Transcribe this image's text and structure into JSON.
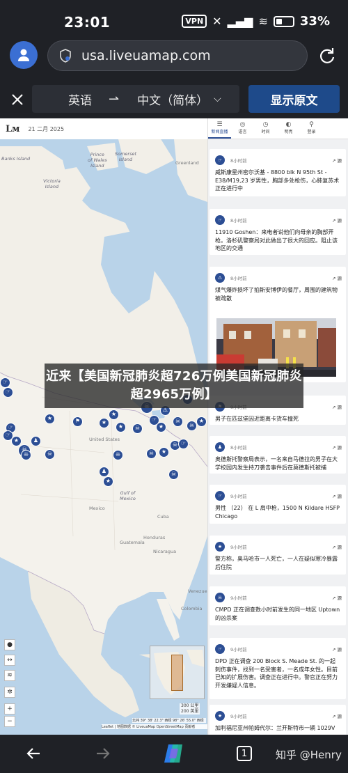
{
  "status_bar": {
    "time": "23:01",
    "vpn": "VPN",
    "battery": "33",
    "battery_suffix": "%"
  },
  "browser": {
    "url": "usa.liveuamap.com"
  },
  "translate": {
    "source_lang": "英语",
    "target_lang": "中文（简体）",
    "show_original": "显示原文"
  },
  "map": {
    "logo": "Lм",
    "date": "21 二月 2025",
    "labels": {
      "banks": "Banks Island",
      "victoria": "Victoria\nIsland",
      "pwales": "Prince\nof Wales\nIsland",
      "somerset": "Somerset\nIsland",
      "greenland": "Greenland",
      "us": "United States",
      "mexico": "Mexico",
      "cuba": "Cuba",
      "gulf": "Gulf of\nMexico",
      "guatemala": "Guatemala",
      "honduras": "Honduras",
      "nicaragua": "Nicaragua",
      "venezuela": "Venezuela",
      "colombia": "Colombia"
    },
    "scale_km": "300 公里",
    "scale_mi": "200 英里",
    "coords": "北纬 39° 38' 22.3\" 西经 98° 26' 55.0\" 西经",
    "attribution": "Leaflet | 地图数据 © LiveuaMap OpenStreetMap 贡献者"
  },
  "feed": {
    "tabs": [
      {
        "label": "新闻直播",
        "icon": "☰"
      },
      {
        "label": "语言",
        "icon": "◎"
      },
      {
        "label": "时间",
        "icon": "◷"
      },
      {
        "label": "明亮",
        "icon": "◐"
      },
      {
        "label": "登录",
        "icon": "⚲"
      }
    ],
    "cards": [
      {
        "time": "8小时前",
        "source": "源",
        "icon": "☞",
        "text": "威斯康星州密尔沃基 - 8800 blk N 95th St - E38/M19,23 岁男性，胸部多处枪伤，心肺复苏术正在进行中"
      },
      {
        "time": "8小时前",
        "source": "源",
        "icon": "☞",
        "text": "11910 Goshen：来电者说他们向母亲的胸部开枪。洛杉矶警察局对此做出了很大的回应。阻止该地区的交通"
      },
      {
        "time": "8小时前",
        "source": "源",
        "icon": "⚠",
        "text": "煤气爆炸损坏了拍斯安博伊的餐厅，周围的建筑物被疏散"
      },
      {
        "time": "9小时前",
        "source": "源",
        "icon": "⚑",
        "text": "男子在匹兹堡因近距离卡货车撞死"
      },
      {
        "time": "8小时前",
        "source": "源",
        "icon": "♟",
        "text": "奥德斯托警察局表示，一名来自马德拉的男子在大学校园内发生持刀袭击事件后在莫德斯托被捕"
      },
      {
        "time": "9小时前",
        "source": "源",
        "icon": "☞",
        "text": "男性 （22） 在 L 肩中枪，1500 N Kildare HSFP Chicago"
      },
      {
        "time": "9小时前",
        "source": "源",
        "icon": "★",
        "text": "警方称，奥马哈市一人死亡，一人在疑似寒冷暴露后住院"
      },
      {
        "time": "9小时前",
        "source": "源",
        "icon": "☠",
        "text": "CMPD 正在调查数小时前发生的同一地区 Uptown 的凶杀案"
      },
      {
        "time": "9小时前",
        "source": "源",
        "icon": "☞",
        "text": "DPD 正在调查 200 Block S. Meade St. 的一起刺伤事件，找到一名受害者，一名成年女性。目前已知的扩展伤害。调查正在进行中。警官正在努力开发嫌疑人信息。"
      },
      {
        "time": "9小时前",
        "source": "源",
        "icon": "★",
        "text": "加利福尼亚州帕姆代尔：兰开斯特市一辆 1029V"
      }
    ]
  },
  "overlay_title": "近来【美国新冠肺炎超726万例美国新冠肺炎超2965万例】",
  "bottom_nav": {
    "tab_count": "1",
    "watermark": "知乎 @Henry"
  }
}
